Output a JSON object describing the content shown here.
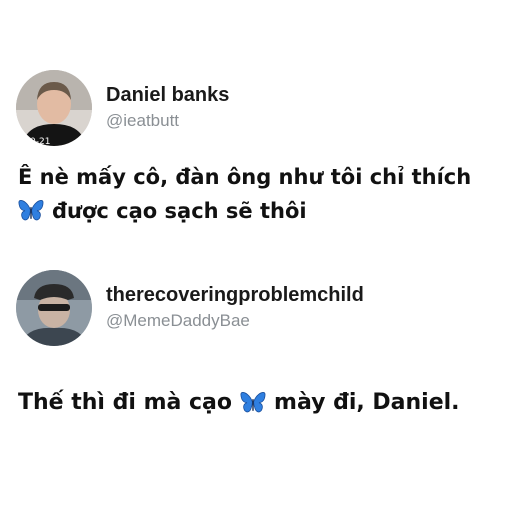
{
  "tweet1": {
    "display_name": "Daniel banks",
    "handle": "@ieatbutt",
    "text_line1": "Ê nè mấy cô, đàn ông như tôi chỉ thích",
    "text_line2": "được cạo sạch sẽ thôi",
    "avatar_icon": "user-photo",
    "emoji_icon": "butterfly-icon"
  },
  "tweet2": {
    "display_name": "therecoveringproblemchild",
    "handle": "@MemeDaddyBae",
    "text_before": "Thế thì đi mà cạo",
    "text_after": "mày đi, Daniel.",
    "avatar_icon": "user-photo",
    "emoji_icon": "butterfly-icon"
  },
  "colors": {
    "text": "#111111",
    "handle": "#8a8f94",
    "butterfly": "#2f7fe0"
  }
}
